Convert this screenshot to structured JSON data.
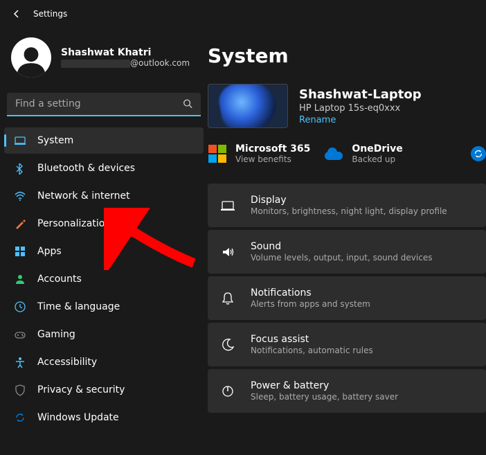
{
  "app_title": "Settings",
  "profile": {
    "name": "Shashwat Khatri",
    "email_suffix": "@outlook.com"
  },
  "search": {
    "placeholder": "Find a setting"
  },
  "nav": [
    {
      "id": "system",
      "label": "System",
      "icon": "display",
      "color": "#4cc2ff"
    },
    {
      "id": "bluetooth",
      "label": "Bluetooth & devices",
      "icon": "bluetooth",
      "color": "#4cc2ff"
    },
    {
      "id": "network",
      "label": "Network & internet",
      "icon": "wifi",
      "color": "#4cc2ff"
    },
    {
      "id": "personalization",
      "label": "Personalization",
      "icon": "brush",
      "color": "#e8713c"
    },
    {
      "id": "apps",
      "label": "Apps",
      "icon": "grid",
      "color": "#4cc2ff"
    },
    {
      "id": "accounts",
      "label": "Accounts",
      "icon": "person",
      "color": "#2ecc71"
    },
    {
      "id": "time",
      "label": "Time & language",
      "icon": "clock",
      "color": "#4cc2ff"
    },
    {
      "id": "gaming",
      "label": "Gaming",
      "icon": "game",
      "color": "#888"
    },
    {
      "id": "accessibility",
      "label": "Accessibility",
      "icon": "access",
      "color": "#4cc2ff"
    },
    {
      "id": "privacy",
      "label": "Privacy & security",
      "icon": "shield",
      "color": "#888"
    },
    {
      "id": "update",
      "label": "Windows Update",
      "icon": "sync",
      "color": "#0078d4"
    }
  ],
  "active_nav": "system",
  "page": {
    "title": "System",
    "device": {
      "name": "Shashwat-Laptop",
      "model": "HP Laptop 15s-eq0xxx",
      "rename_label": "Rename"
    },
    "tiles": {
      "microsoft365": {
        "title": "Microsoft 365",
        "subtitle": "View benefits"
      },
      "onedrive": {
        "title": "OneDrive",
        "subtitle": "Backed up"
      }
    },
    "settings": [
      {
        "id": "display",
        "title": "Display",
        "subtitle": "Monitors, brightness, night light, display profile"
      },
      {
        "id": "sound",
        "title": "Sound",
        "subtitle": "Volume levels, output, input, sound devices"
      },
      {
        "id": "notifications",
        "title": "Notifications",
        "subtitle": "Alerts from apps and system"
      },
      {
        "id": "focus",
        "title": "Focus assist",
        "subtitle": "Notifications, automatic rules"
      },
      {
        "id": "power",
        "title": "Power & battery",
        "subtitle": "Sleep, battery usage, battery saver"
      }
    ]
  }
}
